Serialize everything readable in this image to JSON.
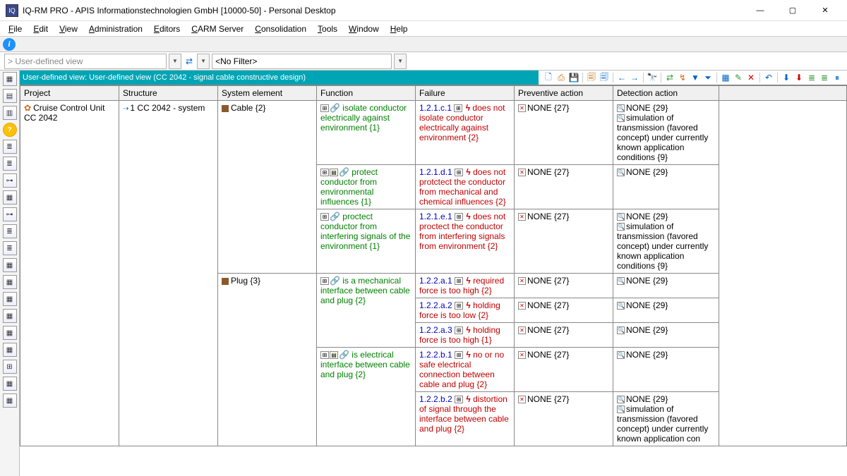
{
  "window": {
    "title": "IQ-RM PRO - APIS Informationstechnologien GmbH [10000-50] - Personal Desktop",
    "min": "—",
    "max": "▢",
    "close": "✕"
  },
  "menu": [
    "File",
    "Edit",
    "View",
    "Administration",
    "Editors",
    "CARM Server",
    "Consolidation",
    "Tools",
    "Window",
    "Help"
  ],
  "filterbar": {
    "view_placeholder": "> User-defined view",
    "filter_value": "<No Filter>"
  },
  "viewheader": {
    "label": "User-defined view: User-defined view (CC 2042 - signal cable constructive design)"
  },
  "columns": [
    "Project",
    "Structure",
    "System element",
    "Function",
    "Failure",
    "Preventive action",
    "Detection action"
  ],
  "root": {
    "project": "Cruise Control Unit CC 2042",
    "structure": "1 CC 2042 - system"
  },
  "none27": "NONE {27}",
  "none29": "NONE {29}",
  "sim9": "simulation of transmission (favored concept) under currently known application conditions {9}",
  "simPartial": "simulation of transmission (favored concept) under currently known application con",
  "elems": [
    {
      "name": "Cable {2}",
      "funcs": [
        {
          "text": "isolate conductor electrically against environment {1}",
          "fail_code": "1.2.1.c.1",
          "fail_text": "does not isolate conductor electrically against environment {2}",
          "det_extra": true,
          "det_label": "sim9"
        },
        {
          "text": "protect conductor from environmental influences {1}",
          "icons_extra": true,
          "fail_code": "1.2.1.d.1",
          "fail_text": "does not protctect the conductor from mechanical and chemical influences {2}",
          "det_extra": false
        },
        {
          "text": "proctect conductor from interfering signals of the environment {1}",
          "fail_code": "1.2.1.e.1",
          "fail_text": "does not proctect the conductor from interfering signals from environment {2}",
          "det_extra": true,
          "det_label": "sim9"
        }
      ]
    },
    {
      "name": "Plug {3}",
      "funcs": [
        {
          "text": "is a mechanical interface between cable and plug {2}",
          "fails": [
            {
              "code": "1.2.2.a.1",
              "text": "required force is too high {2}"
            },
            {
              "code": "1.2.2.a.2",
              "text": "holding force is too low {2}"
            },
            {
              "code": "1.2.2.a.3",
              "text": "holding force is too high {1}"
            }
          ]
        },
        {
          "text": "is electrical interface between cable and plug {2}",
          "icons_extra": true,
          "fails": [
            {
              "code": "1.2.2.b.1",
              "text": "no or no safe electrical connection between cable and plug {2}"
            },
            {
              "code": "1.2.2.b.2",
              "text": "distortion of signal through the interface between cable and plug {2}",
              "det_extra": true,
              "det_label": "simPartial"
            }
          ]
        }
      ]
    }
  ]
}
